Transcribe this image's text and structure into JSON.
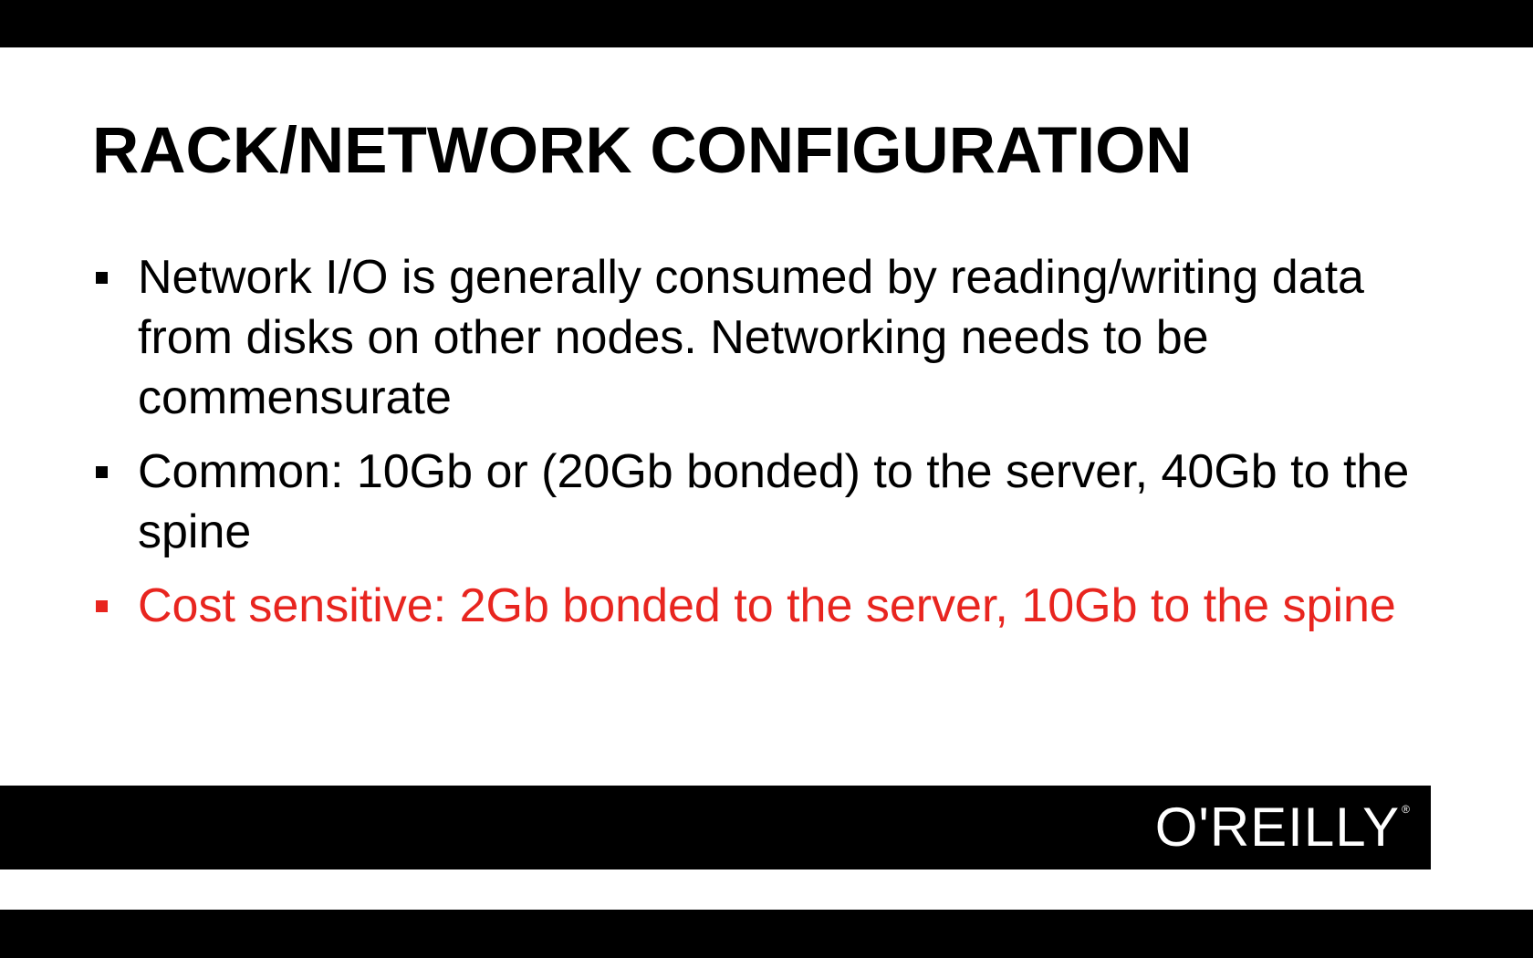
{
  "slide": {
    "title": "RACK/NETWORK CONFIGURATION",
    "bullets": [
      {
        "text": "Network I/O is generally consumed by reading/writing data from disks on other nodes.  Networking needs to be commensurate",
        "highlighted": false
      },
      {
        "text": "Common: 10Gb or (20Gb bonded) to the server, 40Gb to the spine",
        "highlighted": false
      },
      {
        "text": "Cost sensitive: 2Gb bonded to the server, 10Gb to the spine",
        "highlighted": true
      }
    ],
    "highlight_color": "#e8251f"
  },
  "footer": {
    "logo_text": "O'REILLY",
    "logo_mark": "®"
  }
}
